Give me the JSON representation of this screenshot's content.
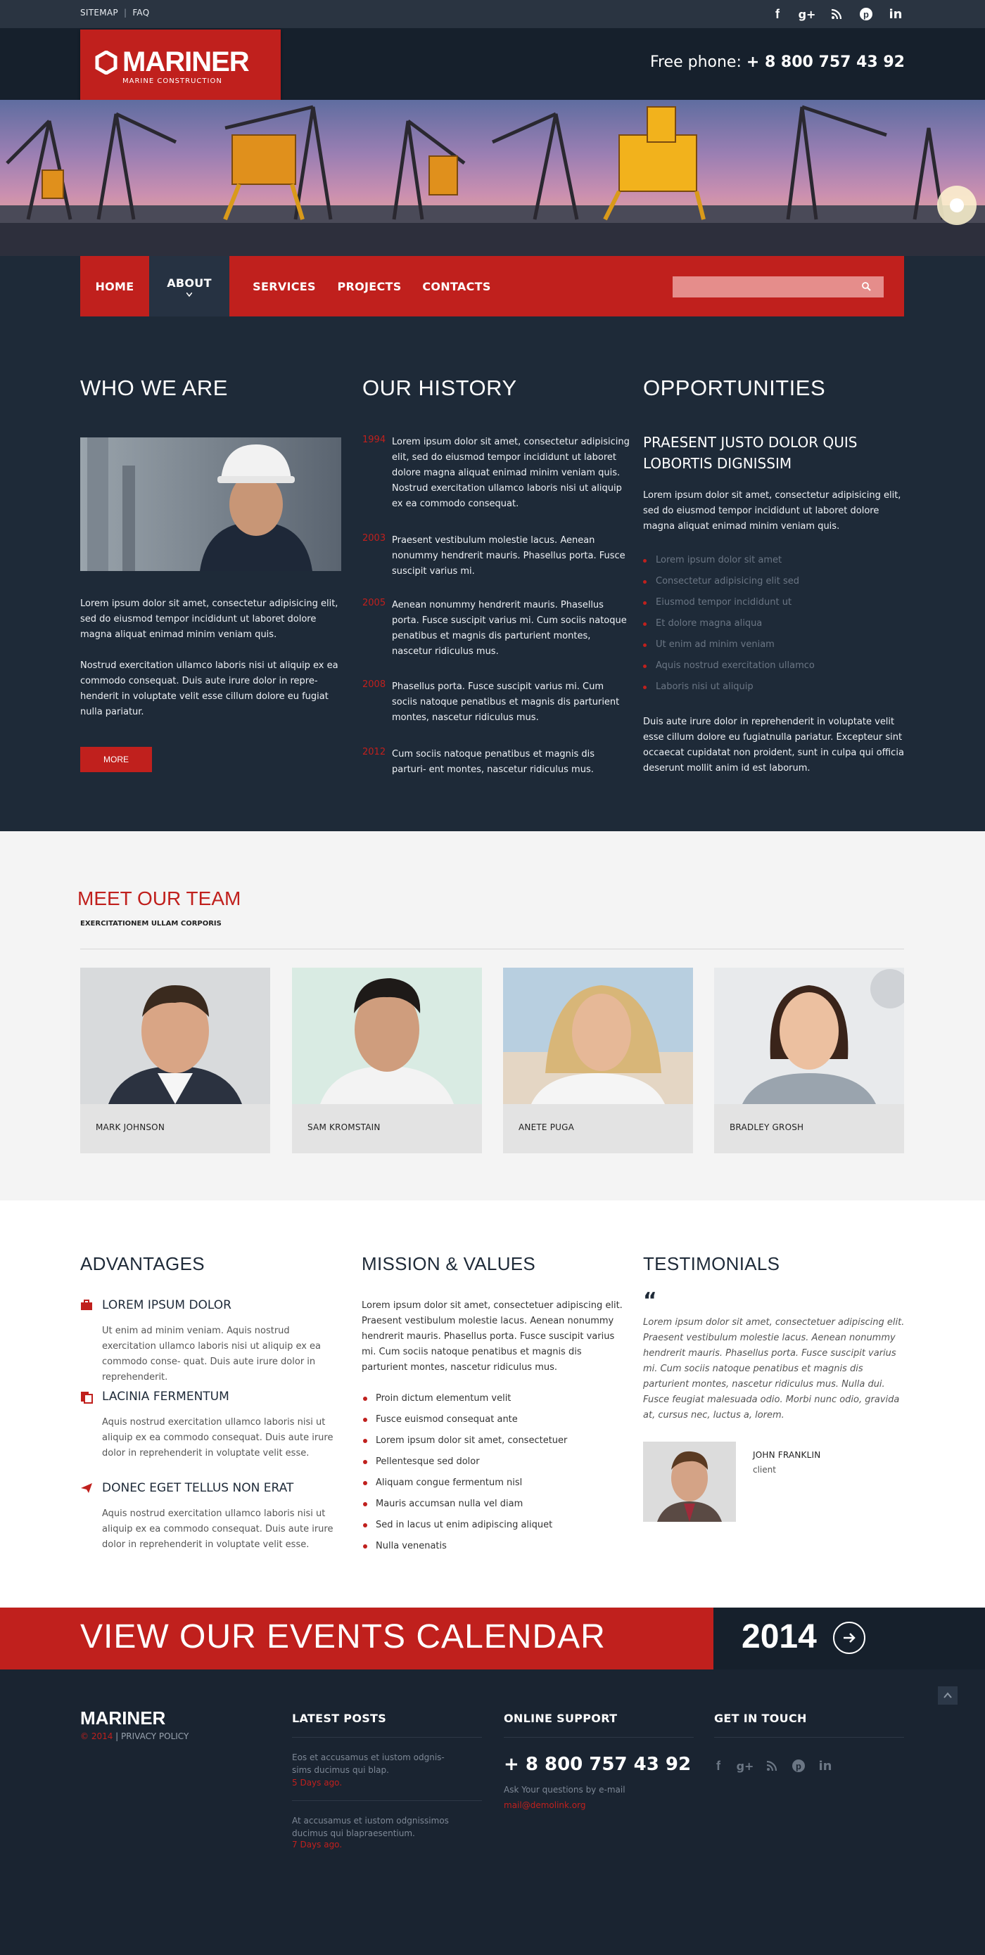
{
  "topbar": {
    "links": [
      "SITEMAP",
      "FAQ"
    ],
    "social_icons": [
      "facebook-icon",
      "google-plus-icon",
      "rss-icon",
      "pinterest-icon",
      "linkedin-icon"
    ]
  },
  "header": {
    "logo_name": "MARINER",
    "logo_sub": "MARINE CONSTRUCTION",
    "phone_label": "Free phone:",
    "phone_number": "+ 8 800 757 43 92"
  },
  "nav": {
    "items": [
      "HOME",
      "ABOUT",
      "SERVICES",
      "PROJECTS",
      "CONTACTS"
    ],
    "active": "ABOUT",
    "search_placeholder": ""
  },
  "who": {
    "title": "WHO WE ARE",
    "p1": "Lorem ipsum dolor sit amet, consectetur adipisicing elit, sed do eiusmod tempor incididunt ut laboret dolore magna aliquat enimad minim veniam quis.",
    "p2": "Nostrud exercitation ullamco laboris nisi ut aliquip ex ea commodo consequat. Duis aute irure dolor in repre- henderit in voluptate velit esse cillum dolore eu fugiat nulla pariatur.",
    "button": "MORE"
  },
  "history": {
    "title": "OUR HISTORY",
    "entries": [
      {
        "year": "1994",
        "text": "Lorem ipsum dolor sit amet, consectetur adipisicing elit, sed do eiusmod tempor incididunt ut laboret dolore magna aliquat enimad minim veniam quis. Nostrud exercitation ullamco laboris nisi ut aliquip ex ea commodo consequat."
      },
      {
        "year": "2003",
        "text": "Praesent vestibulum molestie lacus. Aenean nonummy hendrerit mauris. Phasellus porta. Fusce suscipit varius mi."
      },
      {
        "year": "2005",
        "text": "Aenean nonummy hendrerit mauris. Phasellus porta. Fusce suscipit varius mi. Cum sociis natoque penatibus et magnis dis parturient montes, nascetur ridiculus mus."
      },
      {
        "year": "2008",
        "text": "Phasellus porta. Fusce suscipit varius mi. Cum sociis natoque penatibus et magnis dis parturient montes, nascetur ridiculus mus."
      },
      {
        "year": "2012",
        "text": "Cum sociis natoque penatibus et magnis dis parturi- ent montes, nascetur ridiculus mus."
      }
    ]
  },
  "opportunities": {
    "title": "OPPORTUNITIES",
    "subtitle": "PRAESENT JUSTO DOLOR QUIS LOBORTIS DIGNISSIM",
    "intro": "Lorem ipsum dolor sit amet, consectetur adipisicing elit, sed do eiusmod tempor incididunt ut laboret dolore magna aliquat enimad minim veniam quis.",
    "list": [
      "Lorem ipsum dolor sit amet",
      "Consectetur adipisicing elit sed",
      "Eiusmod tempor incididunt ut",
      "Et dolore magna aliqua",
      "Ut enim ad minim veniam",
      "Aquis nostrud exercitation ullamco",
      "Laboris nisi ut aliquip"
    ],
    "outro": "Duis aute irure dolor in reprehenderit in voluptate velit esse cillum dolore eu fugiatnulla pariatur. Excepteur sint occaecat cupidatat non proident, sunt in culpa qui officia deserunt mollit anim id est laborum."
  },
  "team": {
    "title": "MEET OUR TEAM",
    "subtitle": "EXERCITATIONEM ULLAM CORPORIS",
    "members": [
      "MARK JOHNSON",
      "SAM KROMSTAIN",
      "ANETE PUGA",
      "BRADLEY GROSH"
    ]
  },
  "advantages": {
    "title": "ADVANTAGES",
    "items": [
      {
        "icon": "briefcase-icon",
        "heading": "LOREM IPSUM DOLOR",
        "text": "Ut enim ad minim veniam. Aquis nostrud exercitation ullamco laboris nisi ut aliquip ex ea commodo conse- quat. Duis aute irure dolor in reprehenderit."
      },
      {
        "icon": "documents-icon",
        "heading": "LACINIA FERMENTUM",
        "text": "Aquis nostrud exercitation ullamco laboris nisi ut aliquip ex ea commodo consequat. Duis aute irure dolor in reprehenderit in voluptate velit esse."
      },
      {
        "icon": "paper-plane-icon",
        "heading": "DONEC EGET TELLUS NON ERAT",
        "text": "Aquis nostrud exercitation ullamco laboris nisi ut aliquip ex ea commodo consequat. Duis aute irure dolor in reprehenderit in voluptate velit esse."
      }
    ]
  },
  "mission": {
    "title": "MISSION & VALUES",
    "intro": "Lorem ipsum dolor sit amet, consectetuer adipiscing elit. Praesent vestibulum molestie lacus. Aenean nonummy hendrerit mauris. Phasellus porta. Fusce suscipit varius mi. Cum sociis natoque penatibus et magnis dis parturient montes, nascetur ridiculus mus.",
    "list": [
      "Proin dictum elementum velit",
      "Fusce euismod consequat ante",
      "Lorem ipsum dolor sit amet, consectetuer",
      "Pellentesque sed dolor",
      "Aliquam congue fermentum nisl",
      "Mauris accumsan nulla vel diam",
      "Sed in lacus ut enim adipiscing aliquet",
      "Nulla venenatis"
    ]
  },
  "testimonials": {
    "title": "TESTIMONIALS",
    "quote": "Lorem ipsum dolor sit amet, consectetuer adipiscing elit. Praesent vestibulum molestie lacus. Aenean nonummy hendrerit mauris. Phasellus porta. Fusce suscipit varius mi. Cum sociis natoque penatibus et magnis dis parturient montes, nascetur ridiculus mus. Nulla dui. Fusce feugiat malesuada odio. Morbi nunc odio, gravida at, cursus nec, luctus a, lorem.",
    "author": "JOHN FRANKLIN",
    "role": "client"
  },
  "events": {
    "title": "VIEW OUR EVENTS CALENDAR",
    "year": "2014"
  },
  "footer": {
    "brand": "MARINER",
    "copyright_year": "© 2014",
    "privacy": "PRIVACY POLICY",
    "latest_title": "LATEST POSTS",
    "posts": [
      {
        "text": "Eos et accusamus et iustom odgnis- sims ducimus qui blap.",
        "date": "5 Days ago."
      },
      {
        "text": "At accusamus et iustom odgnissimos ducimus qui blapraesentium.",
        "date": "7 Days ago."
      }
    ],
    "support_title": "ONLINE SUPPORT",
    "support_phone": "+ 8 800 757 43 92",
    "support_note": "Ask Your questions by e-mail",
    "support_email": "mail@demolink.org",
    "touch_title": "GET IN TOUCH"
  }
}
